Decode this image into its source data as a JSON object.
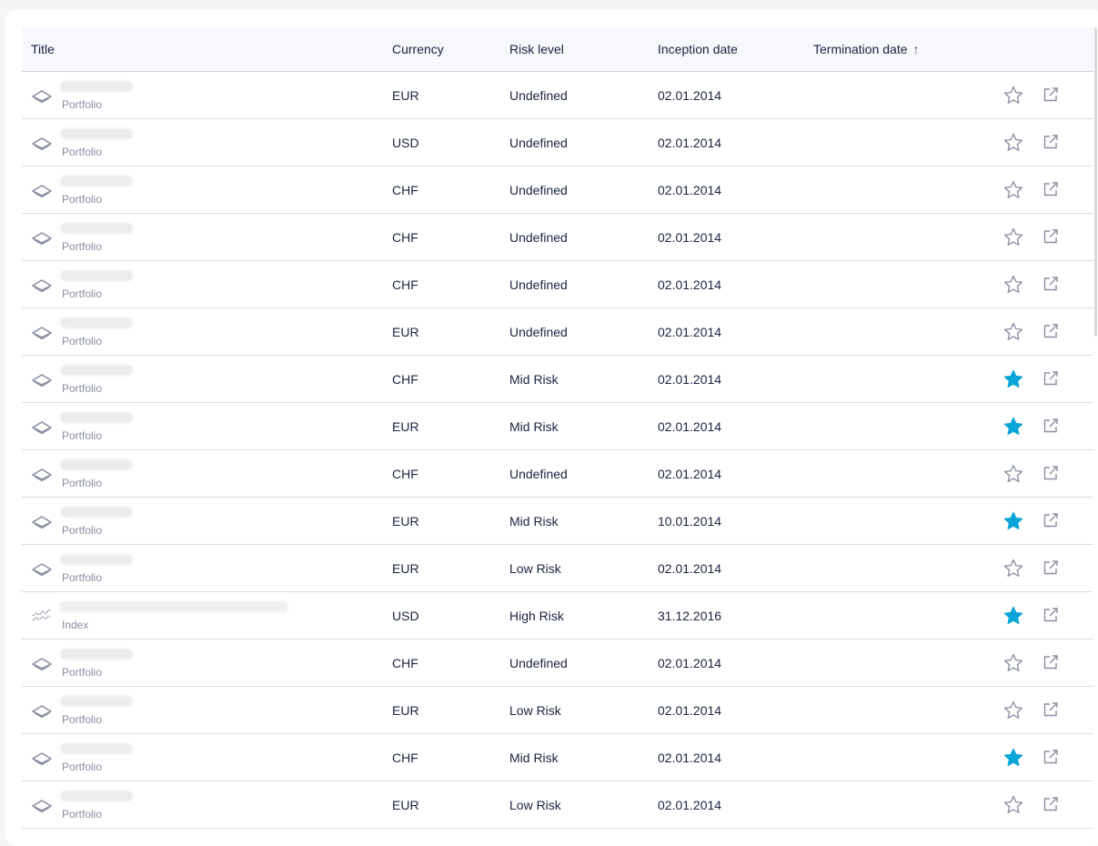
{
  "columns": {
    "title": "Title",
    "currency": "Currency",
    "risk": "Risk level",
    "inception": "Inception date",
    "termination": "Termination date"
  },
  "sort_indicator": "↑",
  "colors": {
    "star_active": "#0aa5d8",
    "star_inactive": "#8e93a8"
  },
  "rows": [
    {
      "type": "Portfolio",
      "currency": "EUR",
      "risk": "Undefined",
      "inception": "02.01.2014",
      "termination": "",
      "favorite": false
    },
    {
      "type": "Portfolio",
      "currency": "USD",
      "risk": "Undefined",
      "inception": "02.01.2014",
      "termination": "",
      "favorite": false
    },
    {
      "type": "Portfolio",
      "currency": "CHF",
      "risk": "Undefined",
      "inception": "02.01.2014",
      "termination": "",
      "favorite": false
    },
    {
      "type": "Portfolio",
      "currency": "CHF",
      "risk": "Undefined",
      "inception": "02.01.2014",
      "termination": "",
      "favorite": false
    },
    {
      "type": "Portfolio",
      "currency": "CHF",
      "risk": "Undefined",
      "inception": "02.01.2014",
      "termination": "",
      "favorite": false
    },
    {
      "type": "Portfolio",
      "currency": "EUR",
      "risk": "Undefined",
      "inception": "02.01.2014",
      "termination": "",
      "favorite": false
    },
    {
      "type": "Portfolio",
      "currency": "CHF",
      "risk": "Mid Risk",
      "inception": "02.01.2014",
      "termination": "",
      "favorite": true
    },
    {
      "type": "Portfolio",
      "currency": "EUR",
      "risk": "Mid Risk",
      "inception": "02.01.2014",
      "termination": "",
      "favorite": true
    },
    {
      "type": "Portfolio",
      "currency": "CHF",
      "risk": "Undefined",
      "inception": "02.01.2014",
      "termination": "",
      "favorite": false
    },
    {
      "type": "Portfolio",
      "currency": "EUR",
      "risk": "Mid Risk",
      "inception": "10.01.2014",
      "termination": "",
      "favorite": true
    },
    {
      "type": "Portfolio",
      "currency": "EUR",
      "risk": "Low Risk",
      "inception": "02.01.2014",
      "termination": "",
      "favorite": false
    },
    {
      "type": "Index",
      "currency": "USD",
      "risk": "High Risk",
      "inception": "31.12.2016",
      "termination": "",
      "favorite": true
    },
    {
      "type": "Portfolio",
      "currency": "CHF",
      "risk": "Undefined",
      "inception": "02.01.2014",
      "termination": "",
      "favorite": false
    },
    {
      "type": "Portfolio",
      "currency": "EUR",
      "risk": "Low Risk",
      "inception": "02.01.2014",
      "termination": "",
      "favorite": false
    },
    {
      "type": "Portfolio",
      "currency": "CHF",
      "risk": "Mid Risk",
      "inception": "02.01.2014",
      "termination": "",
      "favorite": true
    },
    {
      "type": "Portfolio",
      "currency": "EUR",
      "risk": "Low Risk",
      "inception": "02.01.2014",
      "termination": "",
      "favorite": false
    }
  ]
}
